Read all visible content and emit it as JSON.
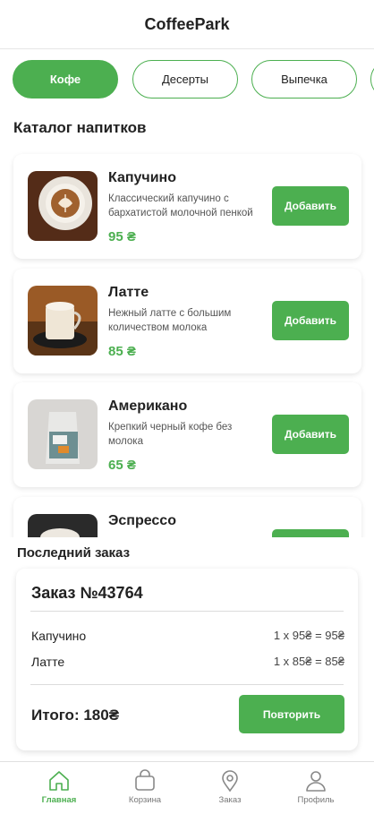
{
  "header": {
    "title": "CoffeePark"
  },
  "categories": [
    {
      "label": "Кофе",
      "active": true
    },
    {
      "label": "Десерты",
      "active": false
    },
    {
      "label": "Выпечка",
      "active": false
    }
  ],
  "catalog": {
    "title": "Каталог напитков",
    "add_label": "Добавить",
    "items": [
      {
        "name": "Капучино",
        "description": "Классический капучино с бархатистой молочной пенкой",
        "price": "95 ₴"
      },
      {
        "name": "Латте",
        "description": "Нежный латте с большим количеством молока",
        "price": "85 ₴"
      },
      {
        "name": "Американо",
        "description": "Крепкий черный кофе без молока",
        "price": "65 ₴"
      },
      {
        "name": "Эспрессо",
        "description": "",
        "price": ""
      }
    ]
  },
  "last_order": {
    "title": "Последний заказ",
    "order_id": "Заказ №43764",
    "lines": [
      {
        "name": "Капучино",
        "calc": "1 x 95₴ = 95₴"
      },
      {
        "name": "Латте",
        "calc": "1 x 85₴ = 85₴"
      }
    ],
    "total": "Итого: 180₴",
    "repeat_label": "Повторить"
  },
  "nav": [
    {
      "label": "Главная",
      "icon": "home-icon",
      "active": true
    },
    {
      "label": "Корзина",
      "icon": "bag-icon",
      "active": false
    },
    {
      "label": "Заказ",
      "icon": "location-pin-icon",
      "active": false
    },
    {
      "label": "Профиль",
      "icon": "user-icon",
      "active": false
    }
  ],
  "colors": {
    "accent": "#4caf50",
    "text": "#222222",
    "muted": "#777777"
  }
}
